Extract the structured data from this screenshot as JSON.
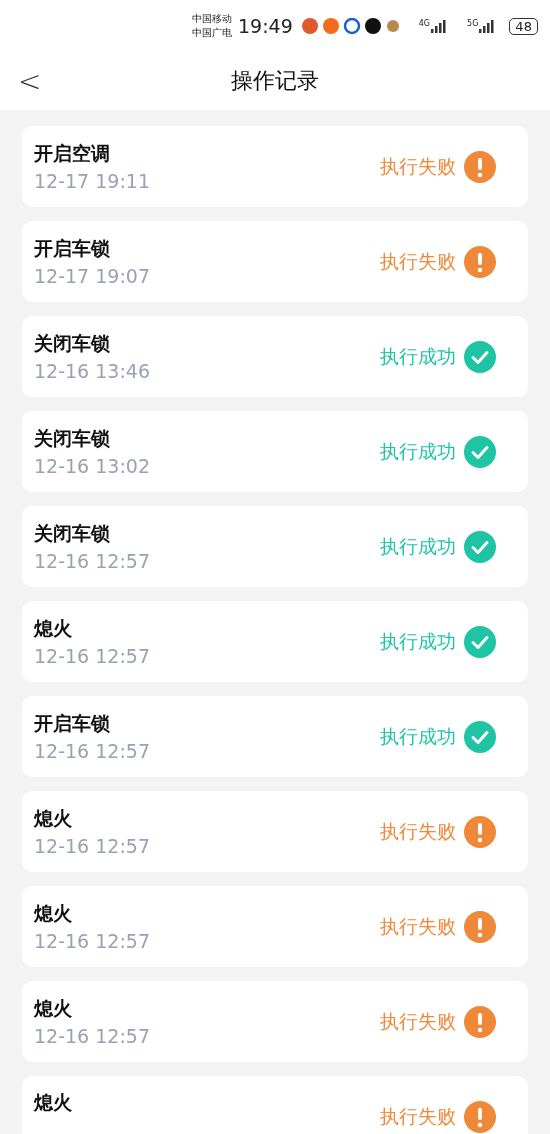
{
  "status_bar": {
    "carriers": [
      "中国移动",
      "中国广电"
    ],
    "time": "19:49",
    "networks": [
      "4G",
      "5G"
    ],
    "battery": "48"
  },
  "header": {
    "back": "<",
    "title": "操作记录"
  },
  "records": [
    {
      "action": "开启空调",
      "time": "12-17 19:11",
      "result": "执行失败",
      "kind": "fail"
    },
    {
      "action": "开启车锁",
      "time": "12-17 19:07",
      "result": "执行失败",
      "kind": "fail"
    },
    {
      "action": "关闭车锁",
      "time": "12-16 13:46",
      "result": "执行成功",
      "kind": "success"
    },
    {
      "action": "关闭车锁",
      "time": "12-16 13:02",
      "result": "执行成功",
      "kind": "success"
    },
    {
      "action": "关闭车锁",
      "time": "12-16 12:57",
      "result": "执行成功",
      "kind": "success"
    },
    {
      "action": "熄火",
      "time": "12-16 12:57",
      "result": "执行成功",
      "kind": "success"
    },
    {
      "action": "开启车锁",
      "time": "12-16 12:57",
      "result": "执行成功",
      "kind": "success"
    },
    {
      "action": "熄火",
      "time": "12-16 12:57",
      "result": "执行失败",
      "kind": "fail"
    },
    {
      "action": "熄火",
      "time": "12-16 12:57",
      "result": "执行失败",
      "kind": "fail"
    },
    {
      "action": "熄火",
      "time": "12-16 12:57",
      "result": "执行失败",
      "kind": "fail"
    },
    {
      "action": "熄火",
      "result": "执行失败",
      "kind": "fail"
    }
  ]
}
